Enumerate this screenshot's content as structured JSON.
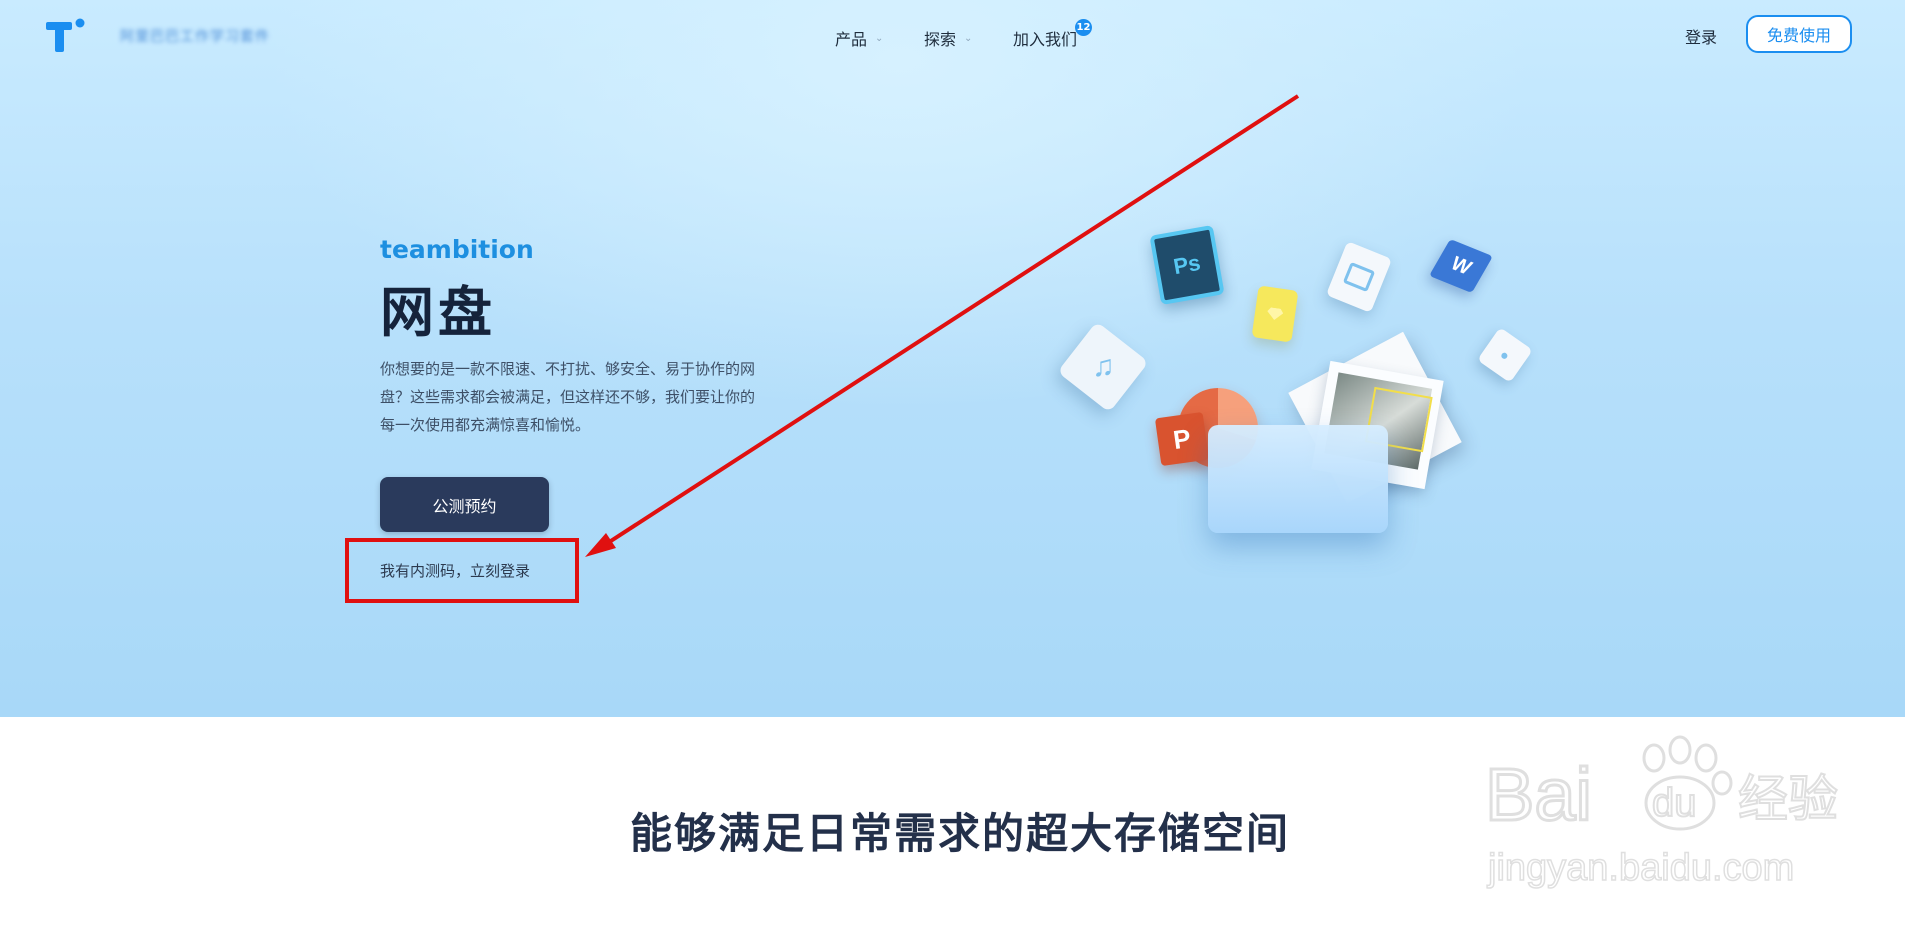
{
  "header": {
    "logo_text": "阿里巴巴工作学习套件",
    "nav": [
      {
        "label": "产品"
      },
      {
        "label": "探索"
      },
      {
        "label": "加入我们"
      }
    ],
    "join_badge": "12",
    "login": "登录",
    "free_use": "免费使用"
  },
  "hero": {
    "brand": "teambition",
    "title": "网盘",
    "description": "你想要的是一款不限速、不打扰、够安全、易于协作的网盘？这些需求都会被满足，但这样还不够，我们要让你的每一次使用都充满惊喜和愉悦。",
    "cta_label": "公测预约",
    "invite_link": "我有内测码，立刻登录"
  },
  "illustration": {
    "icons": [
      "ps-file-icon",
      "word-file-icon",
      "ppt-file-icon",
      "music-file-icon",
      "video-file-icon",
      "sketch-file-icon",
      "image-file-icon",
      "folder-icon",
      "photo-stack-icon"
    ],
    "ps_label": "Ps",
    "word_label": "W",
    "ppt_label": "P"
  },
  "section": {
    "title": "能够满足日常需求的超大存储空间"
  },
  "watermark": {
    "brand": "Bai",
    "brand2": "du",
    "suffix": "经验",
    "url": "jingyan.baidu.com"
  },
  "colors": {
    "accent": "#1b8ef0",
    "cta_bg": "#2a3a5c",
    "annotation": "#e01010",
    "title": "#15233b"
  }
}
